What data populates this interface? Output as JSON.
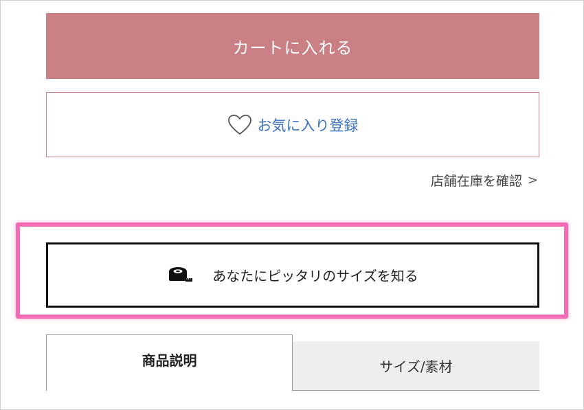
{
  "product_actions": {
    "add_to_cart_label": "カートに入れる",
    "favorite_label": "お気に入り登録",
    "store_stock_label": "店舗在庫を確認",
    "store_stock_chevron": ">",
    "fit_size_label": "あなたにピッタリのサイズを知る"
  },
  "tabs": [
    {
      "label": "商品説明",
      "active": true
    },
    {
      "label": "サイズ/素材",
      "active": false
    }
  ],
  "colors": {
    "cart_button": "#c97f83",
    "favorite_text": "#3a73c4",
    "highlight_outline": "#f26bb5"
  },
  "icons": {
    "favorite": "heart-outline-icon",
    "fit_size": "measuring-tape-icon"
  }
}
